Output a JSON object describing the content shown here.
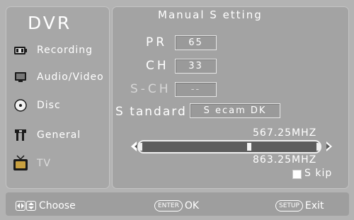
{
  "menu": {
    "title": "DVR",
    "items": [
      {
        "label": "Recording",
        "icon": "recording-icon",
        "enabled": true
      },
      {
        "label": "Audio/Video",
        "icon": "monitor-icon",
        "enabled": true
      },
      {
        "label": "Disc",
        "icon": "disc-icon",
        "enabled": true
      },
      {
        "label": "General",
        "icon": "tools-icon",
        "enabled": true
      },
      {
        "label": "TV",
        "icon": "tv-icon",
        "enabled": false
      }
    ]
  },
  "screen": {
    "title": "Manual S etting",
    "fields": {
      "pr": {
        "label": "PR",
        "value": "65"
      },
      "ch": {
        "label": "CH",
        "value": "33"
      },
      "sch": {
        "label": "S-CH",
        "value": "--"
      },
      "standard": {
        "label": "S tandard",
        "value": "S ecam DK"
      }
    },
    "frequency_upper": "567.25MHZ",
    "frequency_lower": "863.25MHZ",
    "skip_label": "S kip",
    "skip_checked": false,
    "slider_level": 0.62
  },
  "footer": {
    "choose": {
      "label": "Choose"
    },
    "ok": {
      "key": "ENTER",
      "label": "OK"
    },
    "exit": {
      "key": "SETUP",
      "label": "Exit"
    }
  },
  "colors": {
    "background": "#b3b3b3",
    "panel": "#a7a7a7",
    "text": "#ffffff",
    "disabled_text": "#d6d6d6",
    "slider_track": "#5d5d5d"
  }
}
